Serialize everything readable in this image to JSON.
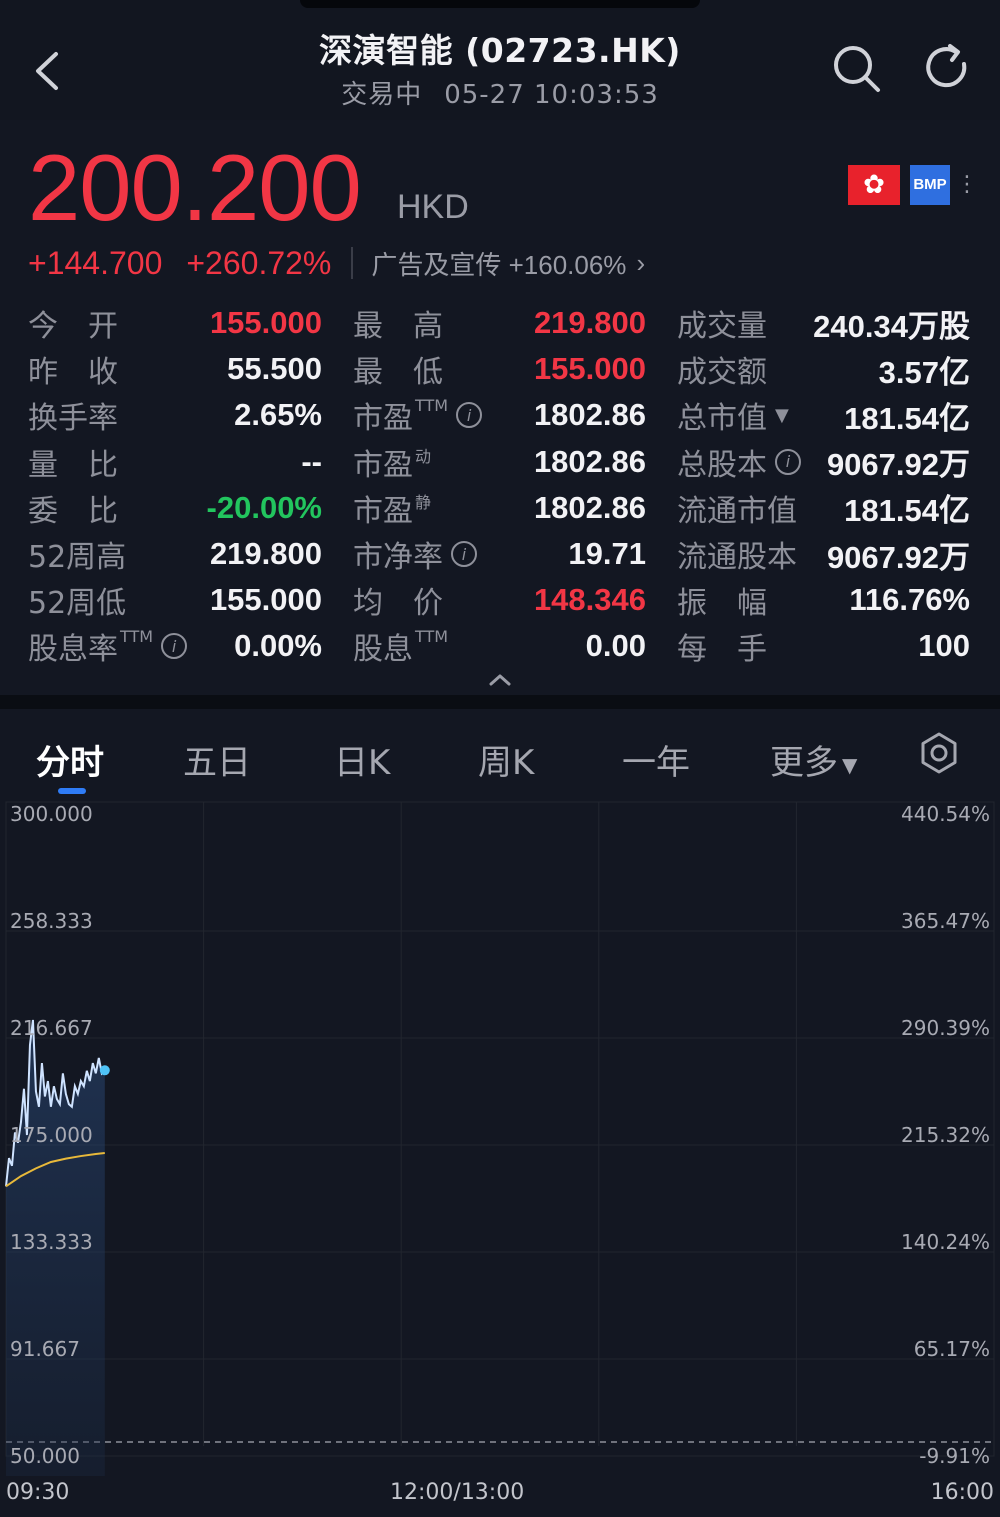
{
  "header": {
    "title": "深演智能 (02723.HK)",
    "status": "交易中",
    "datetime": "05-27 10:03:53"
  },
  "quote": {
    "price": "200.200",
    "currency": "HKD",
    "change": "+144.700",
    "change_pct": "+260.72%",
    "industry": "广告及宣传 +160.06%",
    "badge_bmp": "BMP"
  },
  "stats": [
    [
      {
        "label": "今　开",
        "value": "155.000",
        "tone": "up"
      },
      {
        "label": "最　高",
        "value": "219.800",
        "tone": "up"
      },
      {
        "label": "成交量",
        "value": "240.34万股",
        "tone": ""
      }
    ],
    [
      {
        "label": "昨　收",
        "value": "55.500",
        "tone": ""
      },
      {
        "label": "最　低",
        "value": "155.000",
        "tone": "up"
      },
      {
        "label": "成交额",
        "value": "3.57亿",
        "tone": ""
      }
    ],
    [
      {
        "label": "换手率",
        "value": "2.65%",
        "tone": ""
      },
      {
        "label": "市盈",
        "sup": "TTM",
        "info": true,
        "value": "1802.86",
        "tone": ""
      },
      {
        "label": "总市值",
        "tri": true,
        "value": "181.54亿",
        "tone": ""
      }
    ],
    [
      {
        "label": "量　比",
        "value": "--",
        "tone": ""
      },
      {
        "label": "市盈",
        "sup": "动",
        "value": "1802.86",
        "tone": ""
      },
      {
        "label": "总股本",
        "info": true,
        "value": "9067.92万",
        "tone": ""
      }
    ],
    [
      {
        "label": "委　比",
        "value": "-20.00%",
        "tone": "down"
      },
      {
        "label": "市盈",
        "sup": "静",
        "value": "1802.86",
        "tone": ""
      },
      {
        "label": "流通市值",
        "value": "181.54亿",
        "tone": ""
      }
    ],
    [
      {
        "label": "52周高",
        "value": "219.800",
        "tone": ""
      },
      {
        "label": "市净率",
        "info": true,
        "value": "19.71",
        "tone": ""
      },
      {
        "label": "流通股本",
        "value": "9067.92万",
        "tone": ""
      }
    ],
    [
      {
        "label": "52周低",
        "value": "155.000",
        "tone": ""
      },
      {
        "label": "均　价",
        "value": "148.346",
        "tone": "up"
      },
      {
        "label": "振　幅",
        "value": "116.76%",
        "tone": ""
      }
    ],
    [
      {
        "label": "股息率",
        "sup": "TTM",
        "info": true,
        "value": "0.00%",
        "tone": ""
      },
      {
        "label": "股息",
        "sup": "TTM",
        "value": "0.00",
        "tone": ""
      },
      {
        "label": "每　手",
        "value": "100",
        "tone": ""
      }
    ]
  ],
  "tabs": [
    "分时",
    "五日",
    "日K",
    "周K",
    "一年",
    "更多"
  ],
  "active_tab": 0,
  "colors": {
    "up": "#f23645",
    "down": "#22c55e",
    "accent": "#2f7cf6",
    "price_line": "#cfe3ff",
    "avg_line": "#e8b93a"
  },
  "icons": {
    "back": "chevron-left-icon",
    "search": "search-icon",
    "refresh": "refresh-icon",
    "settings": "settings-icon",
    "hk_flag": "hk-flag-icon"
  },
  "chart_data": {
    "type": "line",
    "title": "",
    "ylim": [
      50.0,
      300.0
    ],
    "y_ticks_left": [
      "300.000",
      "258.333",
      "216.667",
      "175.000",
      "133.333",
      "91.667",
      "50.000"
    ],
    "y_ticks_right": [
      "440.54%",
      "365.47%",
      "290.39%",
      "215.32%",
      "140.24%",
      "65.17%",
      "-9.91%"
    ],
    "x_ticks": [
      "09:30",
      "12:00/13:00",
      "16:00"
    ],
    "series": [
      {
        "role": "price",
        "x": [
          "09:30",
          "09:31",
          "09:32",
          "09:33",
          "09:34",
          "09:35",
          "09:36",
          "09:37",
          "09:38",
          "09:39",
          "09:40",
          "09:41",
          "09:42",
          "09:43",
          "09:44",
          "09:45",
          "09:46",
          "09:47",
          "09:48",
          "09:49",
          "09:50",
          "09:51",
          "09:52",
          "09:53",
          "09:54",
          "09:55",
          "09:56",
          "09:57",
          "09:58",
          "09:59",
          "10:00",
          "10:01",
          "10:02",
          "10:03"
        ],
        "values": [
          155.0,
          166.0,
          163.0,
          176.0,
          172.0,
          180.0,
          193.0,
          175.0,
          210.0,
          219.8,
          192.0,
          186.0,
          203.0,
          190.0,
          196.0,
          186.0,
          194.0,
          189.0,
          187.0,
          199.0,
          191.0,
          187.0,
          186.0,
          194.0,
          191.0,
          196.0,
          194.0,
          200.0,
          196.0,
          203.0,
          199.0,
          205.0,
          199.0,
          200.2
        ]
      },
      {
        "role": "average",
        "x": [
          "09:30",
          "09:35",
          "09:40",
          "09:45",
          "09:50",
          "09:55",
          "10:00",
          "10:03"
        ],
        "values": [
          155.0,
          159.0,
          162.0,
          164.5,
          165.8,
          166.8,
          167.6,
          168.0
        ]
      }
    ]
  }
}
